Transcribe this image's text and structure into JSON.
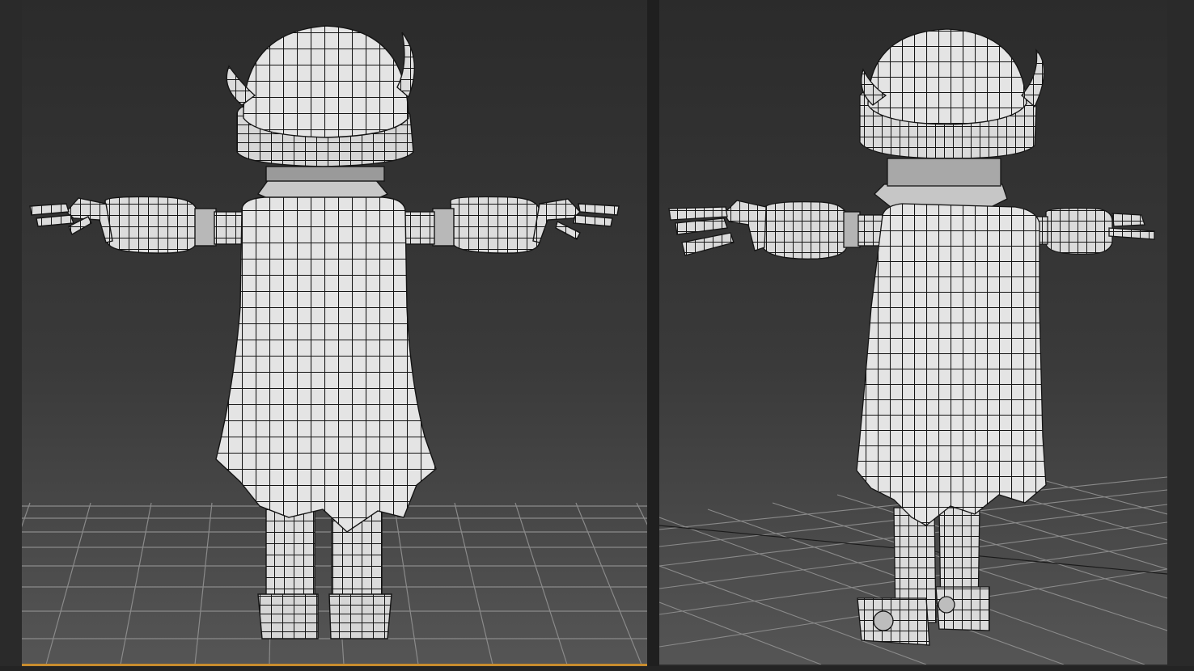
{
  "app": {
    "layout": "two-viewports",
    "active_viewport": "left"
  },
  "viewports": [
    {
      "id": "left",
      "view": "orthographic-back",
      "grid": true,
      "active": true
    },
    {
      "id": "right",
      "view": "perspective",
      "grid": true,
      "active": false
    }
  ],
  "model": {
    "shading": "shaded-with-wireframe",
    "pose": "T-pose",
    "parts": [
      "head-icon",
      "horn-icon",
      "cape-icon",
      "arm-icon",
      "hand-icon",
      "leg-icon",
      "boot-icon"
    ]
  },
  "colors": {
    "background_top": "#2b2b2b",
    "background_bottom": "#555555",
    "grid_line": "#8a8a8a",
    "mesh_fill": "#dcdcdc",
    "wire": "#151515",
    "active_border": "#c88c2e"
  }
}
